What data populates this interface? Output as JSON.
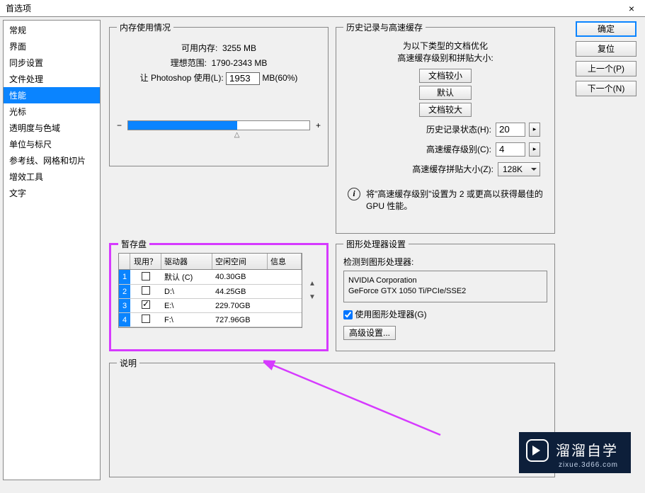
{
  "title": "首选项",
  "sidebar": {
    "items": [
      "常规",
      "界面",
      "同步设置",
      "文件处理",
      "性能",
      "光标",
      "透明度与色域",
      "单位与标尺",
      "参考线、网格和切片",
      "增效工具",
      "文字"
    ],
    "selected_index": 4
  },
  "buttons": {
    "ok": "确定",
    "reset": "复位",
    "prev": "上一个(P)",
    "next": "下一个(N)"
  },
  "memory": {
    "legend": "内存使用情况",
    "available_label": "可用内存:",
    "available_value": "3255 MB",
    "ideal_label": "理想范围:",
    "ideal_value": "1790-2343 MB",
    "let_label": "让 Photoshop 使用(L):",
    "use_value": "1953",
    "use_suffix": "MB(60%)",
    "minus": "−",
    "plus": "+"
  },
  "history": {
    "legend": "历史记录与高速缓存",
    "note1": "为以下类型的文档优化",
    "note2": "高速缓存级别和拼贴大小:",
    "btn_small": "文档较小",
    "btn_default": "默认",
    "btn_large": "文档较大",
    "states_label": "历史记录状态(H):",
    "states_value": "20",
    "cache_label": "高速缓存级别(C):",
    "cache_value": "4",
    "tile_label": "高速缓存拼贴大小(Z):",
    "tile_value": "128K",
    "info_text": "将\"高速缓存级别\"设置为 2 或更高以获得最佳的 GPU 性能。"
  },
  "scratch": {
    "legend": "暂存盘",
    "headers": {
      "use": "现用？",
      "drive": "驱动器",
      "free": "空闲空间",
      "info": "信息"
    },
    "rows": [
      {
        "n": "1",
        "checked": false,
        "drive": "默认 (C)",
        "free": "40.30GB",
        "info": ""
      },
      {
        "n": "2",
        "checked": false,
        "drive": "D:\\",
        "free": "44.25GB",
        "info": ""
      },
      {
        "n": "3",
        "checked": true,
        "drive": "E:\\",
        "free": "229.70GB",
        "info": ""
      },
      {
        "n": "4",
        "checked": false,
        "drive": "F:\\",
        "free": "727.96GB",
        "info": ""
      }
    ]
  },
  "gpu": {
    "legend": "图形处理器设置",
    "detected_label": "检测到图形处理器:",
    "vendor": "NVIDIA Corporation",
    "model": "GeForce GTX 1050 Ti/PCIe/SSE2",
    "use_label": "使用图形处理器(G)",
    "advanced": "高级设置..."
  },
  "desc": {
    "legend": "说明"
  },
  "watermark": {
    "text": "溜溜自学",
    "sub": "zixue.3d66.com"
  }
}
